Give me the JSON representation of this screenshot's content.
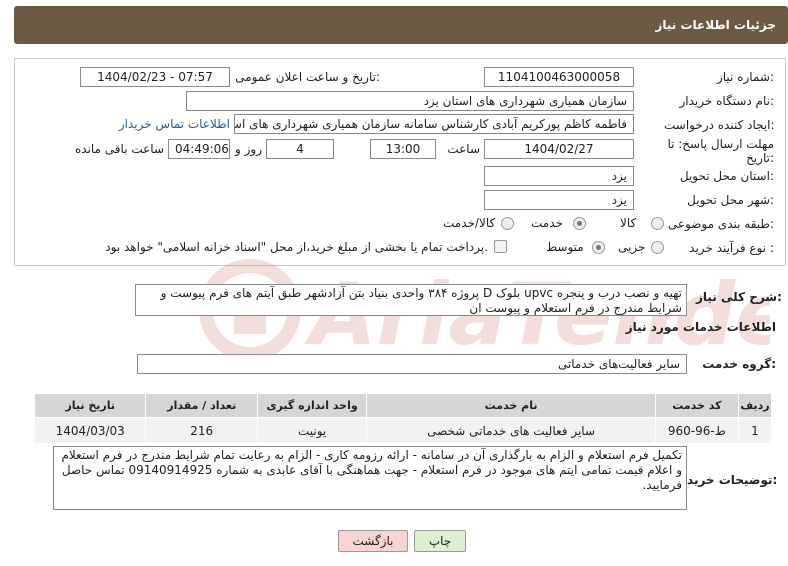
{
  "header": {
    "title": "جزئیات اطلاعات نیاز"
  },
  "fields": {
    "need_number_label": "شماره نیاز:",
    "need_number": "1104100463000058",
    "announce_label": "تاریخ و ساعت اعلان عمومی:",
    "announce_value": "1404/02/23 - 07:57",
    "buyer_org_label": "نام دستگاه خریدار:",
    "buyer_org": "سازمان همیاری شهرداری های استان یزد",
    "creator_label": "ایجاد کننده درخواست:",
    "creator": "فاطمه کاظم پورکریم آبادی کارشناس سامانه سازمان همیاری شهرداری های اس",
    "contact_link": "اطلاعات تماس خریدار",
    "deadline_label": "مهلت ارسال پاسخ: تا",
    "deadline_label2": "تاریخ:",
    "deadline_date": "1404/02/27",
    "time_label": "ساعت",
    "deadline_time": "13:00",
    "days_value": "4",
    "days_label": "روز و",
    "remaining_time": "04:49:06",
    "remaining_label": "ساعت باقی مانده",
    "province_label": "استان محل تحویل:",
    "province": "یزد",
    "city_label": "شهر محل تحویل:",
    "city": "یزد",
    "category_label": "طبقه بندی موضوعی:",
    "category_options": [
      "کالا",
      "خدمت",
      "کالا/خدمت"
    ],
    "category_selected": "خدمت",
    "process_label": "نوع فرآیند خرید :",
    "process_options": [
      "جزیی",
      "متوسط"
    ],
    "process_selected": "متوسط",
    "payment_note": "پرداخت تمام یا بخشی از مبلغ خرید،از محل \"اسناد خزانه اسلامی\" خواهد بود."
  },
  "description": {
    "label": "شرح کلی نیاز:",
    "text": "تهیه و نصب درب و پنجره upvc بلوک D پروژه ۳۸۴ واحدی بنیاد بتن آزادشهر طبق آیتم های فرم پیوست و شرایط مندرج در فرم استعلام و پیوست ان"
  },
  "services": {
    "section_title": "اطلاعات خدمات مورد نیاز",
    "group_label": "گروه خدمت:",
    "group_value": "سایر فعالیت‌های خدماتی",
    "columns": [
      "ردیف",
      "کد خدمت",
      "نام خدمت",
      "واحد اندازه گیری",
      "تعداد / مقدار",
      "تاریخ نیاز"
    ],
    "rows": [
      [
        "1",
        "ط-96-960",
        "سایر فعالیت های خدماتی شخصی",
        "یونیت",
        "216",
        "1404/03/03"
      ]
    ]
  },
  "buyer_notes": {
    "label": "توضیحات خریدار:",
    "text": "تکمیل فرم استعلام و الزام به بارگذاری آن در سامانه - ارائه رزومه کاری - الزام به رعایت تمام شرایط مندرج در فرم استعلام و اعلام قیمت تمامی ایتم های موجود در فرم استعلام - جهت هماهنگی با آقای عابدی به شماره 09140914925 تماس حاصل فرمایید."
  },
  "buttons": {
    "print": "چاپ",
    "back": "بازگشت"
  },
  "watermark": {
    "text": "AriaTender.neT"
  },
  "colors": {
    "header_bg": "#6d5a45",
    "link": "#2a5aa8",
    "print_bg": "#dff0d0",
    "back_bg": "#f7d4d4",
    "watermark": "#c0392b"
  }
}
